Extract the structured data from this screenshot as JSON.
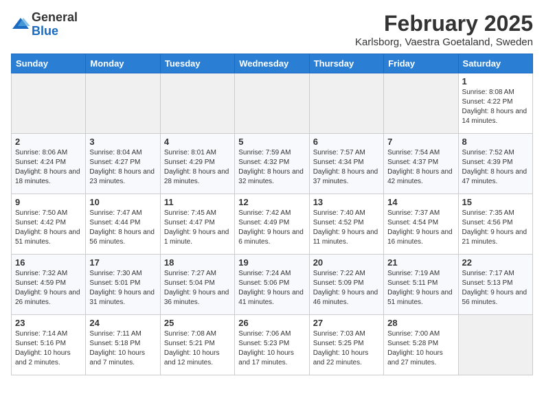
{
  "logo": {
    "general": "General",
    "blue": "Blue"
  },
  "title": "February 2025",
  "subtitle": "Karlsborg, Vaestra Goetaland, Sweden",
  "weekdays": [
    "Sunday",
    "Monday",
    "Tuesday",
    "Wednesday",
    "Thursday",
    "Friday",
    "Saturday"
  ],
  "weeks": [
    [
      {
        "day": "",
        "info": ""
      },
      {
        "day": "",
        "info": ""
      },
      {
        "day": "",
        "info": ""
      },
      {
        "day": "",
        "info": ""
      },
      {
        "day": "",
        "info": ""
      },
      {
        "day": "",
        "info": ""
      },
      {
        "day": "1",
        "info": "Sunrise: 8:08 AM\nSunset: 4:22 PM\nDaylight: 8 hours and 14 minutes."
      }
    ],
    [
      {
        "day": "2",
        "info": "Sunrise: 8:06 AM\nSunset: 4:24 PM\nDaylight: 8 hours and 18 minutes."
      },
      {
        "day": "3",
        "info": "Sunrise: 8:04 AM\nSunset: 4:27 PM\nDaylight: 8 hours and 23 minutes."
      },
      {
        "day": "4",
        "info": "Sunrise: 8:01 AM\nSunset: 4:29 PM\nDaylight: 8 hours and 28 minutes."
      },
      {
        "day": "5",
        "info": "Sunrise: 7:59 AM\nSunset: 4:32 PM\nDaylight: 8 hours and 32 minutes."
      },
      {
        "day": "6",
        "info": "Sunrise: 7:57 AM\nSunset: 4:34 PM\nDaylight: 8 hours and 37 minutes."
      },
      {
        "day": "7",
        "info": "Sunrise: 7:54 AM\nSunset: 4:37 PM\nDaylight: 8 hours and 42 minutes."
      },
      {
        "day": "8",
        "info": "Sunrise: 7:52 AM\nSunset: 4:39 PM\nDaylight: 8 hours and 47 minutes."
      }
    ],
    [
      {
        "day": "9",
        "info": "Sunrise: 7:50 AM\nSunset: 4:42 PM\nDaylight: 8 hours and 51 minutes."
      },
      {
        "day": "10",
        "info": "Sunrise: 7:47 AM\nSunset: 4:44 PM\nDaylight: 8 hours and 56 minutes."
      },
      {
        "day": "11",
        "info": "Sunrise: 7:45 AM\nSunset: 4:47 PM\nDaylight: 9 hours and 1 minute."
      },
      {
        "day": "12",
        "info": "Sunrise: 7:42 AM\nSunset: 4:49 PM\nDaylight: 9 hours and 6 minutes."
      },
      {
        "day": "13",
        "info": "Sunrise: 7:40 AM\nSunset: 4:52 PM\nDaylight: 9 hours and 11 minutes."
      },
      {
        "day": "14",
        "info": "Sunrise: 7:37 AM\nSunset: 4:54 PM\nDaylight: 9 hours and 16 minutes."
      },
      {
        "day": "15",
        "info": "Sunrise: 7:35 AM\nSunset: 4:56 PM\nDaylight: 9 hours and 21 minutes."
      }
    ],
    [
      {
        "day": "16",
        "info": "Sunrise: 7:32 AM\nSunset: 4:59 PM\nDaylight: 9 hours and 26 minutes."
      },
      {
        "day": "17",
        "info": "Sunrise: 7:30 AM\nSunset: 5:01 PM\nDaylight: 9 hours and 31 minutes."
      },
      {
        "day": "18",
        "info": "Sunrise: 7:27 AM\nSunset: 5:04 PM\nDaylight: 9 hours and 36 minutes."
      },
      {
        "day": "19",
        "info": "Sunrise: 7:24 AM\nSunset: 5:06 PM\nDaylight: 9 hours and 41 minutes."
      },
      {
        "day": "20",
        "info": "Sunrise: 7:22 AM\nSunset: 5:09 PM\nDaylight: 9 hours and 46 minutes."
      },
      {
        "day": "21",
        "info": "Sunrise: 7:19 AM\nSunset: 5:11 PM\nDaylight: 9 hours and 51 minutes."
      },
      {
        "day": "22",
        "info": "Sunrise: 7:17 AM\nSunset: 5:13 PM\nDaylight: 9 hours and 56 minutes."
      }
    ],
    [
      {
        "day": "23",
        "info": "Sunrise: 7:14 AM\nSunset: 5:16 PM\nDaylight: 10 hours and 2 minutes."
      },
      {
        "day": "24",
        "info": "Sunrise: 7:11 AM\nSunset: 5:18 PM\nDaylight: 10 hours and 7 minutes."
      },
      {
        "day": "25",
        "info": "Sunrise: 7:08 AM\nSunset: 5:21 PM\nDaylight: 10 hours and 12 minutes."
      },
      {
        "day": "26",
        "info": "Sunrise: 7:06 AM\nSunset: 5:23 PM\nDaylight: 10 hours and 17 minutes."
      },
      {
        "day": "27",
        "info": "Sunrise: 7:03 AM\nSunset: 5:25 PM\nDaylight: 10 hours and 22 minutes."
      },
      {
        "day": "28",
        "info": "Sunrise: 7:00 AM\nSunset: 5:28 PM\nDaylight: 10 hours and 27 minutes."
      },
      {
        "day": "",
        "info": ""
      }
    ]
  ]
}
